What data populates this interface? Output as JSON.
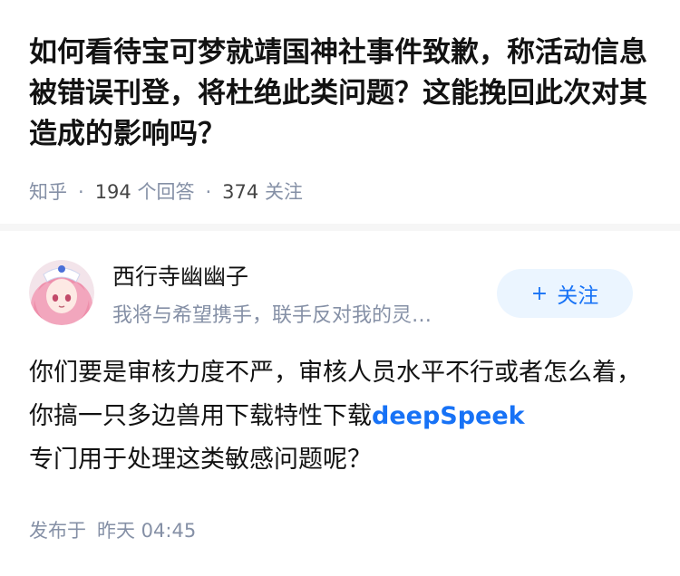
{
  "question": {
    "title": "如何看待宝可梦就靖国神社事件致歉，称活动信息被错误刊登，将杜绝此类问题？这能挽回此次对其造成的影响吗？"
  },
  "meta": {
    "source": "知乎",
    "answer_count": "194",
    "answer_label": "个回答",
    "follower_count": "374",
    "follower_label": "关注"
  },
  "author": {
    "name": "西行寺幽幽子",
    "bio": "我将与希望携手，联手反对我的灵…",
    "follow_plus": "+",
    "follow_label": "关注"
  },
  "answer": {
    "text_before": "你们要是审核力度不严，审核人员水平不行或者怎么着，你搞一只多边兽用下载特性下载",
    "link_text": "deepSpeek",
    "text_after": "专门用于处理这类敏感问题呢？"
  },
  "published": {
    "label": "发布于",
    "time": "昨天 04:45"
  },
  "colors": {
    "link_blue": "#1772f6",
    "muted_gray": "#8590a6",
    "follow_bg": "#ebf5ff"
  }
}
